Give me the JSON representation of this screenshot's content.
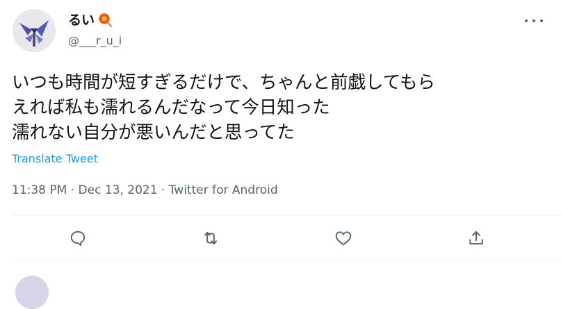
{
  "user": {
    "display_name": "るい",
    "handle": "@___r_u_i",
    "emoji_icon": "lollipop-icon"
  },
  "tweet": {
    "lines": [
      "いつも時間が短すぎるだけで、ちゃんと前戯してもら",
      "えれば私も濡れるんだなって今日知った",
      "濡れない自分が悪いんだと思ってた"
    ],
    "translate_label": "Translate Tweet",
    "meta": "11:38 PM · Dec 13, 2021 · Twitter for Android"
  },
  "actions": [
    "reply-icon",
    "retweet-icon",
    "like-icon",
    "share-icon"
  ],
  "colors": {
    "text": "#0f1419",
    "secondary": "#536471",
    "link": "#1d9bf0",
    "divider": "#eff3f4"
  }
}
